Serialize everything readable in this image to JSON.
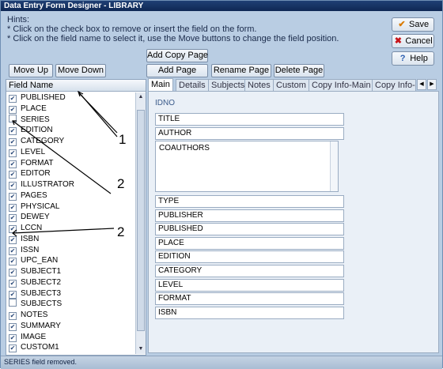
{
  "window": {
    "title": "Data Entry Form Designer - LIBRARY"
  },
  "hints": {
    "heading": "Hints:",
    "line1": "* Click on the check box to remove or insert the field on the form.",
    "line2": "* Click on the field name to select it, use the Move buttons to change the field position."
  },
  "buttons": {
    "move_up": "Move Up",
    "move_down": "Move Down",
    "add_copy_page": "Add Copy Page",
    "add_page": "Add Page",
    "rename_page": "Rename Page",
    "delete_page": "Delete Page",
    "save": "Save",
    "cancel": "Cancel",
    "help": "Help"
  },
  "icons": {
    "save": "check-icon",
    "cancel": "x-icon",
    "help": "question-icon"
  },
  "colors": {
    "save_icon": "#d97a00",
    "cancel_icon": "#c8141a",
    "help_icon": "#2a5db0",
    "titlebar": "#1f3f74"
  },
  "field_list": {
    "header": "Field Name",
    "items": [
      {
        "name": "PUBLISHED",
        "checked": true
      },
      {
        "name": "PLACE",
        "checked": true
      },
      {
        "name": "SERIES",
        "checked": false
      },
      {
        "name": "EDITION",
        "checked": true
      },
      {
        "name": "CATEGORY",
        "checked": true
      },
      {
        "name": "LEVEL",
        "checked": true
      },
      {
        "name": "FORMAT",
        "checked": true
      },
      {
        "name": "EDITOR",
        "checked": true
      },
      {
        "name": "ILLUSTRATOR",
        "checked": true
      },
      {
        "name": "PAGES",
        "checked": true
      },
      {
        "name": "PHYSICAL",
        "checked": true
      },
      {
        "name": "DEWEY",
        "checked": true
      },
      {
        "name": "LCCN",
        "checked": true
      },
      {
        "name": "ISBN",
        "checked": true
      },
      {
        "name": "ISSN",
        "checked": true
      },
      {
        "name": "UPC_EAN",
        "checked": true
      },
      {
        "name": "SUBJECT1",
        "checked": true
      },
      {
        "name": "SUBJECT2",
        "checked": true
      },
      {
        "name": "SUBJECT3",
        "checked": true
      },
      {
        "name": "SUBJECTS",
        "checked": false
      },
      {
        "name": "NOTES",
        "checked": true
      },
      {
        "name": "SUMMARY",
        "checked": true
      },
      {
        "name": "IMAGE",
        "checked": true
      },
      {
        "name": "CUSTOM1",
        "checked": true
      }
    ]
  },
  "tabs": [
    "Main",
    "Details",
    "Subjects",
    "Notes",
    "Custom",
    "Copy Info-Main",
    "Copy Info-"
  ],
  "active_tab": "Main",
  "form": {
    "idno": "IDNO",
    "fields_top": [
      "TITLE",
      "AUTHOR"
    ],
    "coauthors": "COAUTHORS",
    "fields_bottom": [
      "TYPE",
      "PUBLISHER",
      "PUBLISHED",
      "PLACE",
      "EDITION",
      "CATEGORY",
      "LEVEL",
      "FORMAT",
      "ISBN"
    ]
  },
  "status": {
    "text": "SERIES field removed."
  },
  "annotations": {
    "label_1": "1",
    "label_2a": "2",
    "label_2b": "2"
  }
}
